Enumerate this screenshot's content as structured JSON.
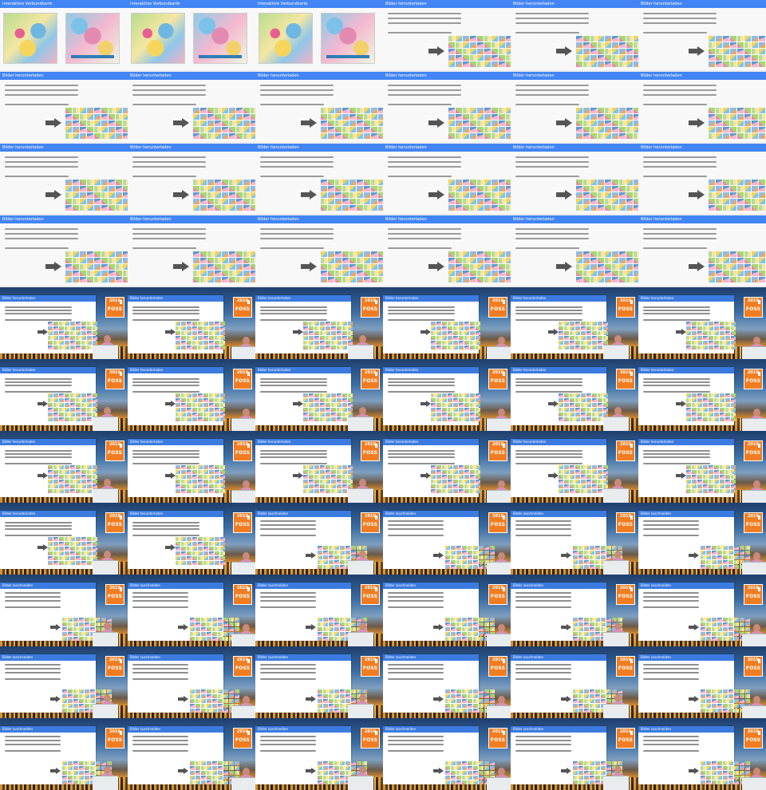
{
  "sheet": {
    "columns": 6,
    "rows": 11,
    "colors": {
      "slide_title_bar": "#4285f4",
      "logo": "#f07d22",
      "speaker_shirt": "#d68fb6"
    },
    "slide_titles": {
      "map": "Interaktive Verbundkarte",
      "download": "Bilder herunterladen",
      "combine": "Bilder zuschneiden"
    },
    "logo": {
      "year": "2019",
      "name": "FOSS",
      "icon": "fossgis-logo"
    },
    "frames": [
      {
        "kind": "map"
      },
      {
        "kind": "map"
      },
      {
        "kind": "map"
      },
      {
        "kind": "download"
      },
      {
        "kind": "download"
      },
      {
        "kind": "download"
      },
      {
        "kind": "download"
      },
      {
        "kind": "download"
      },
      {
        "kind": "download"
      },
      {
        "kind": "download"
      },
      {
        "kind": "download"
      },
      {
        "kind": "download"
      },
      {
        "kind": "download"
      },
      {
        "kind": "download"
      },
      {
        "kind": "download"
      },
      {
        "kind": "download"
      },
      {
        "kind": "download"
      },
      {
        "kind": "download"
      },
      {
        "kind": "download"
      },
      {
        "kind": "download"
      },
      {
        "kind": "download"
      },
      {
        "kind": "download"
      },
      {
        "kind": "download"
      },
      {
        "kind": "download"
      },
      {
        "kind": "video-download"
      },
      {
        "kind": "video-download"
      },
      {
        "kind": "video-download"
      },
      {
        "kind": "video-download"
      },
      {
        "kind": "video-download"
      },
      {
        "kind": "video-download"
      },
      {
        "kind": "video-download"
      },
      {
        "kind": "video-download"
      },
      {
        "kind": "video-download"
      },
      {
        "kind": "video-download"
      },
      {
        "kind": "video-download"
      },
      {
        "kind": "video-download"
      },
      {
        "kind": "video-download"
      },
      {
        "kind": "video-download"
      },
      {
        "kind": "video-download"
      },
      {
        "kind": "video-download"
      },
      {
        "kind": "video-download"
      },
      {
        "kind": "video-download"
      },
      {
        "kind": "video-download"
      },
      {
        "kind": "video-download"
      },
      {
        "kind": "video-combine"
      },
      {
        "kind": "video-combine"
      },
      {
        "kind": "video-combine"
      },
      {
        "kind": "video-combine"
      },
      {
        "kind": "video-combine"
      },
      {
        "kind": "video-combine"
      },
      {
        "kind": "video-combine"
      },
      {
        "kind": "video-combine"
      },
      {
        "kind": "video-combine"
      },
      {
        "kind": "video-combine"
      },
      {
        "kind": "video-combine"
      },
      {
        "kind": "video-combine"
      },
      {
        "kind": "video-combine"
      },
      {
        "kind": "video-combine"
      },
      {
        "kind": "video-combine"
      },
      {
        "kind": "video-combine"
      },
      {
        "kind": "video-combine"
      },
      {
        "kind": "video-combine"
      },
      {
        "kind": "video-combine"
      },
      {
        "kind": "video-combine"
      },
      {
        "kind": "video-combine"
      },
      {
        "kind": "video-combine"
      }
    ]
  }
}
